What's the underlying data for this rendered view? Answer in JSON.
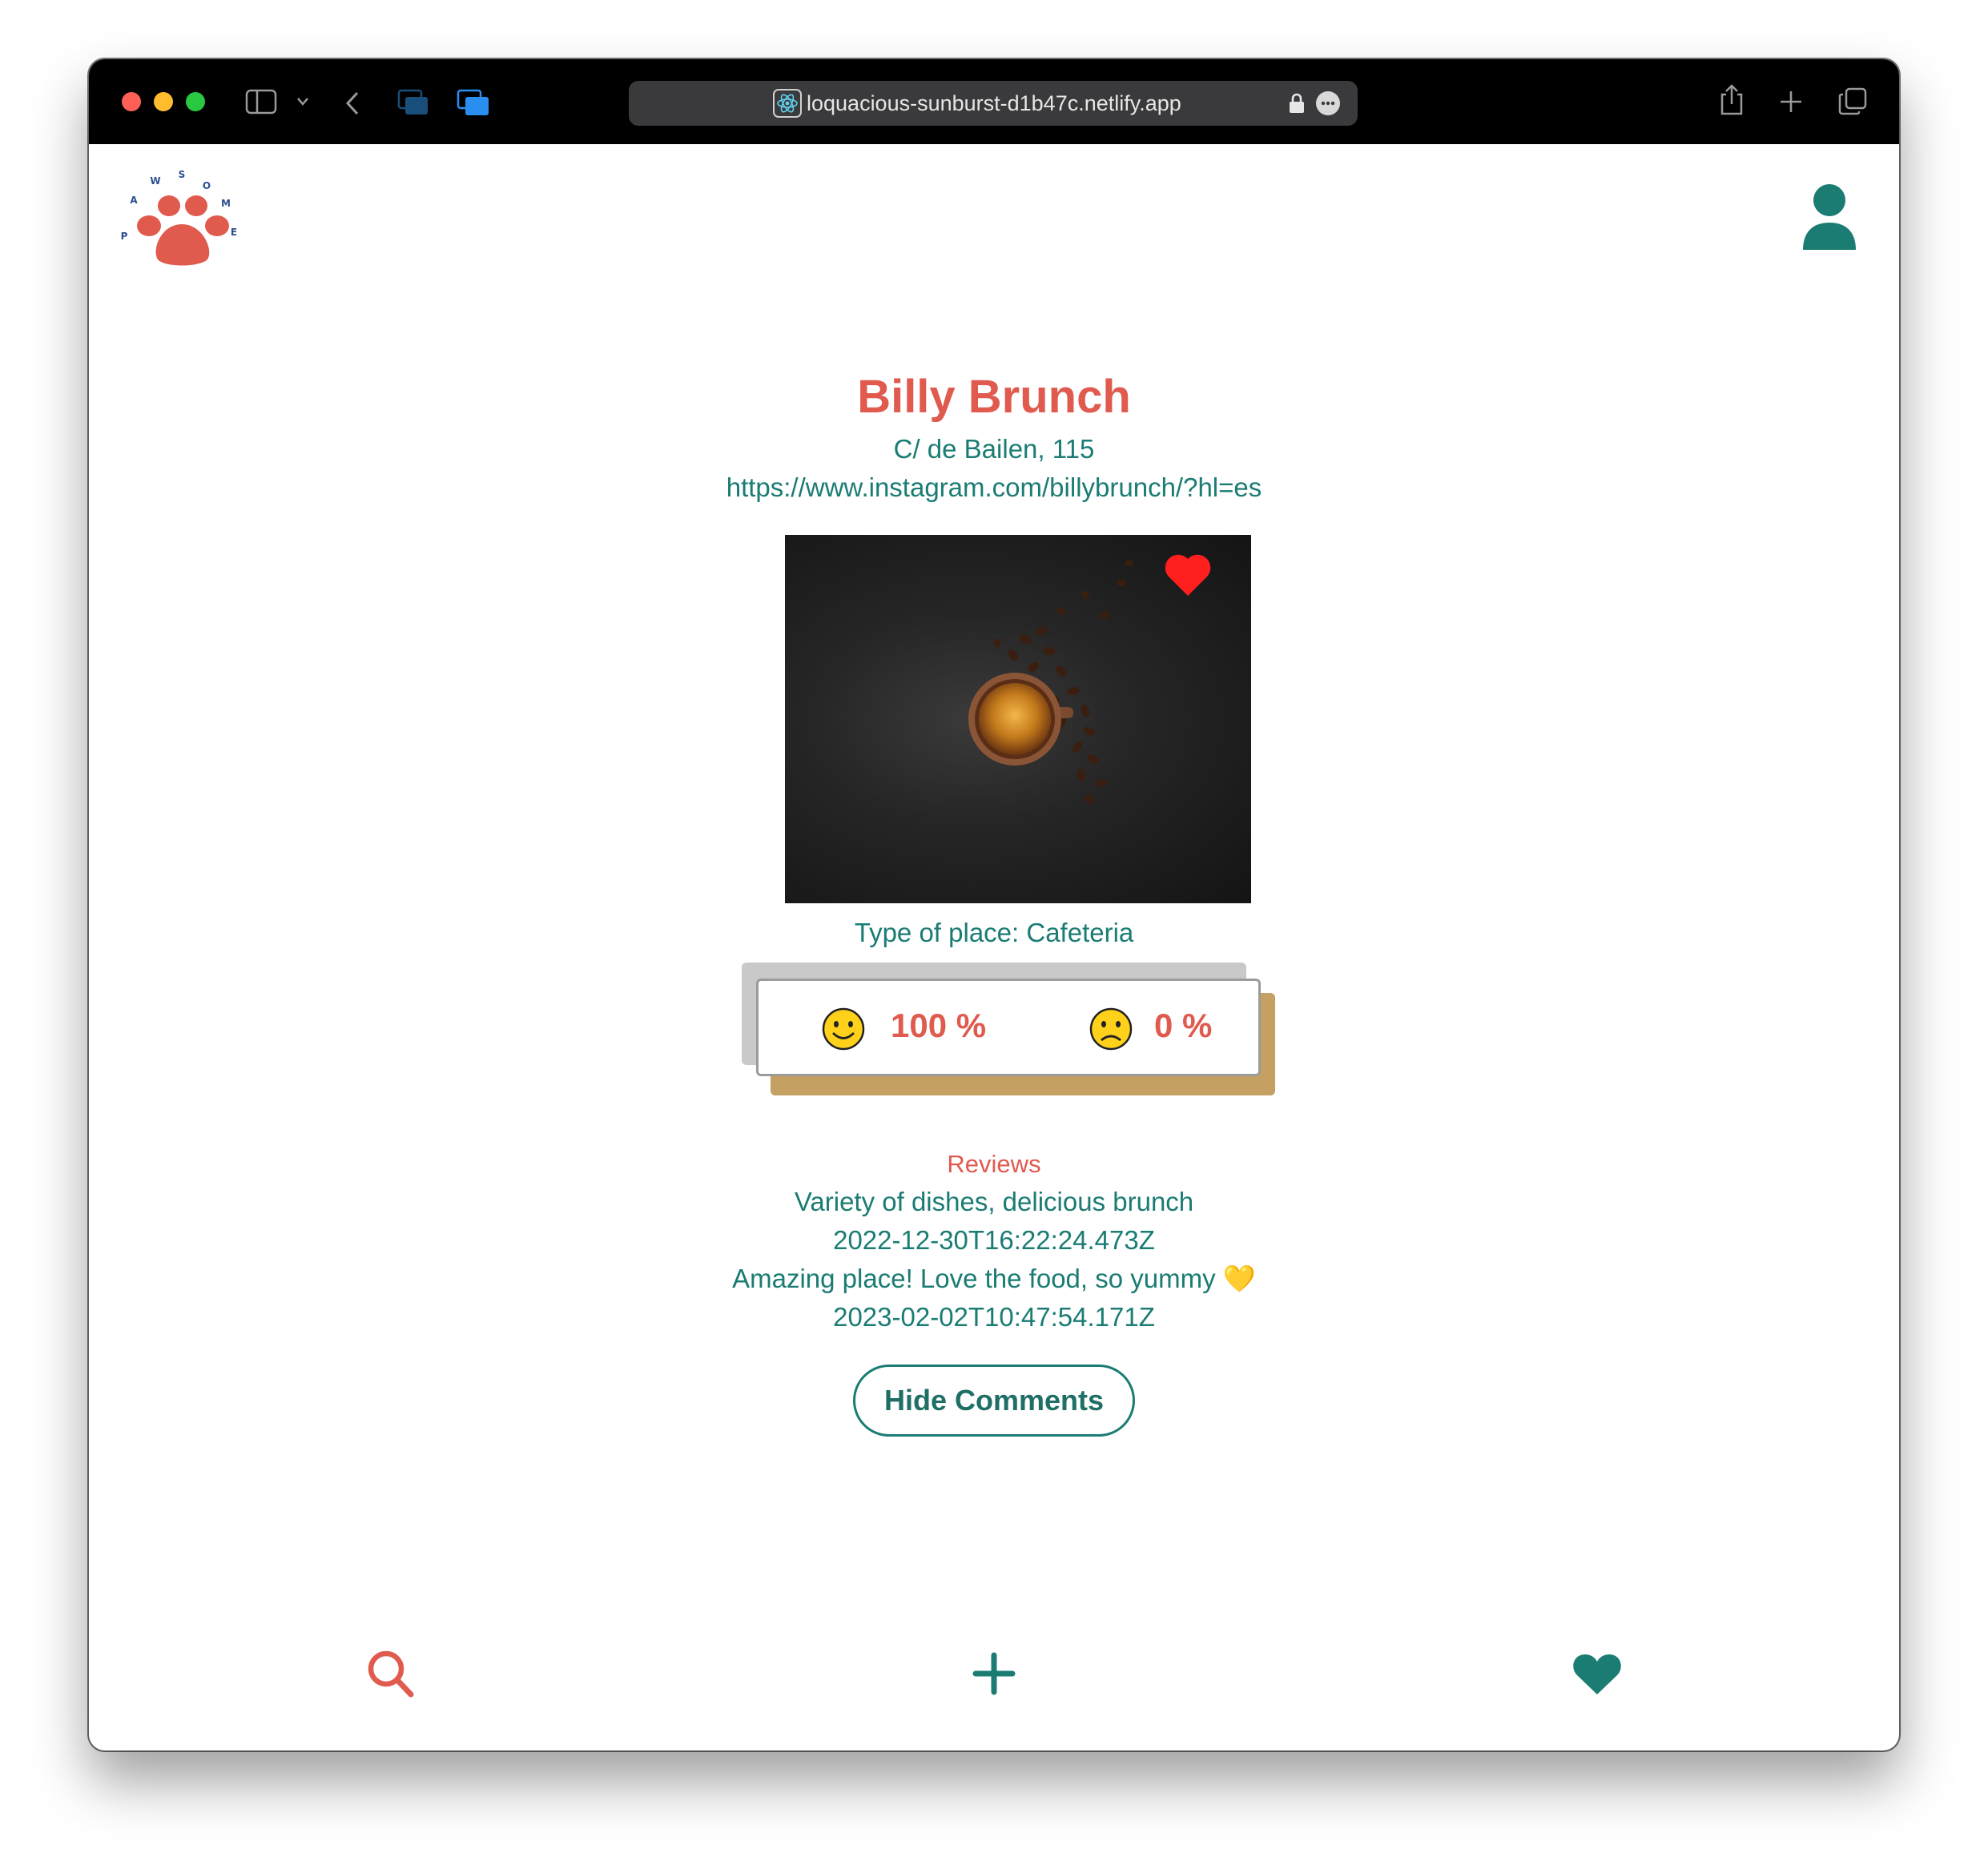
{
  "browser": {
    "url": "loquacious-sunburst-d1b47c.netlify.app"
  },
  "logo": {
    "letters": "PAWSOME"
  },
  "place": {
    "name": "Billy Brunch",
    "address": "C/ de Bailen, 115",
    "website": "https://www.instagram.com/billybrunch/?hl=es",
    "type_of_place": "Type of place: Cafeteria",
    "is_favorite": true
  },
  "ratings": {
    "positive": "100 %",
    "negative": "0 %"
  },
  "reviews": {
    "heading": "Reviews",
    "items": [
      {
        "text": "Variety of dishes, delicious brunch",
        "date": "2022-12-30T16:22:24.473Z"
      },
      {
        "text": "Amazing place! Love the food, so yummy 💛",
        "date": "2023-02-02T10:47:54.171Z"
      }
    ],
    "hide_label": "Hide Comments"
  },
  "colors": {
    "brand_red": "#e05a4e",
    "brand_teal": "#1a7c73",
    "gold": "#c4a063"
  },
  "bottom_nav": [
    "search-icon",
    "add-icon",
    "favorites-heart-icon"
  ]
}
